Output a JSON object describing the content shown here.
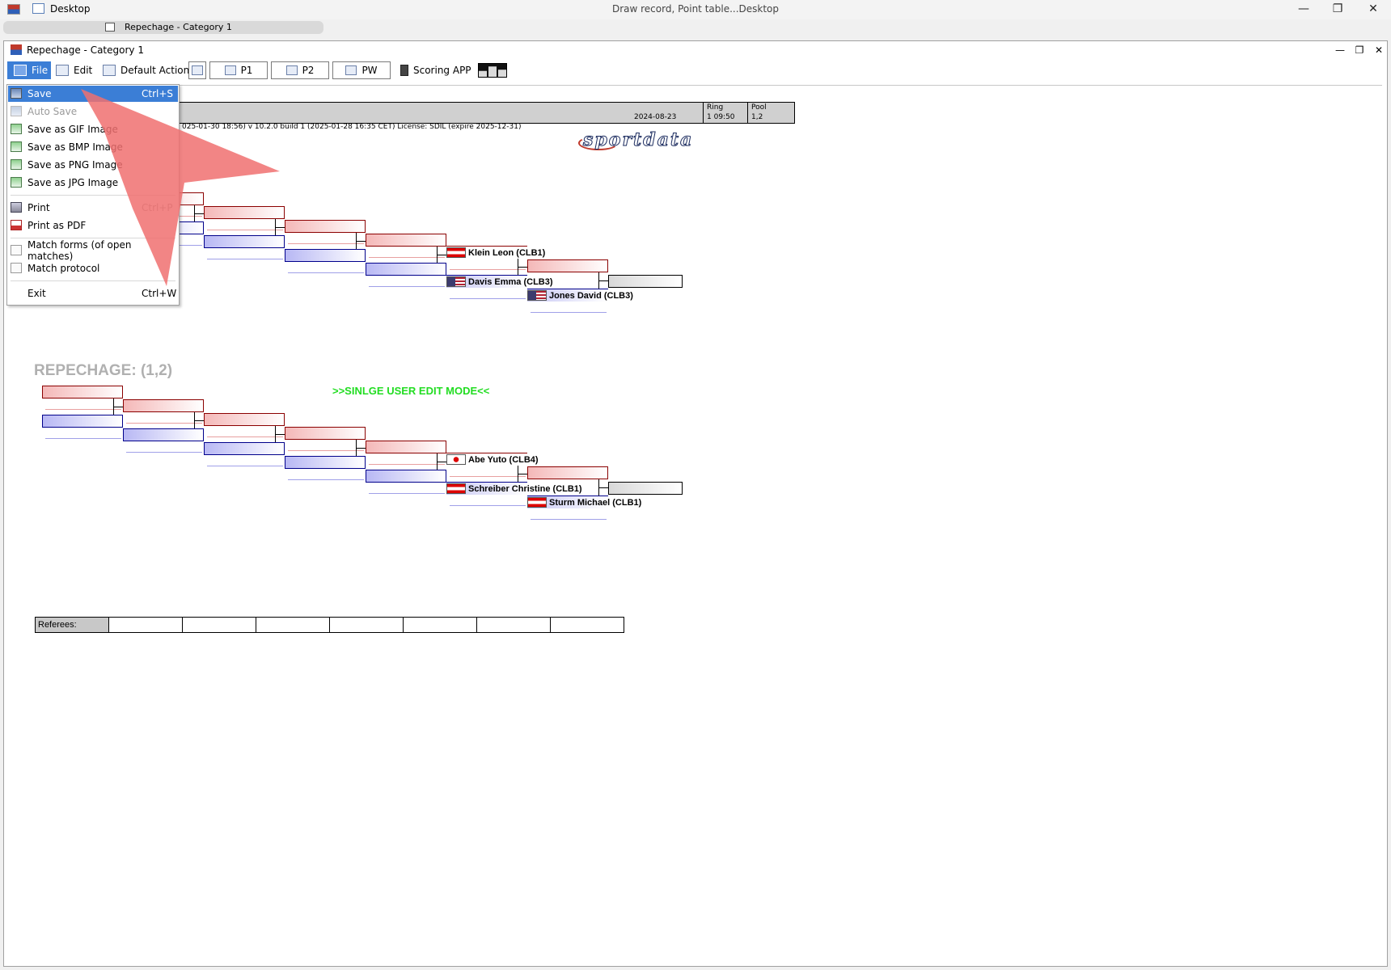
{
  "os": {
    "desktop_label": "Desktop",
    "center_title": "Draw record, Point table...Desktop",
    "tab_label": "Repechage - Category 1",
    "minimize": "—",
    "maximize": "❐",
    "close": "✕"
  },
  "window": {
    "title": "Repechage - Category 1",
    "minimize": "—",
    "restore": "❐",
    "close": "✕"
  },
  "toolbar": {
    "file": "File",
    "edit": "Edit",
    "default_action": "Default Action",
    "p1": "P1",
    "p2": "P2",
    "pw": "PW",
    "scoring_app": "Scoring APP"
  },
  "header": {
    "date": "2024-08-23",
    "ring_caption": "Ring",
    "ring_value": "1 09:50",
    "pool_caption": "Pool",
    "pool_value": "1,2",
    "version_line": "025-01-30 18:56)  v 10.2.0 build 1 (2025-01-28 16:35 CET) License: SDIL (expire 2025-12-31)"
  },
  "logo": {
    "text": "sportdata"
  },
  "section": {
    "title": "REPECHAGE:  (1,2)",
    "mode": ">>SINLGE USER EDIT MODE<<"
  },
  "bracket1": {
    "red_final": "Klein Leon (CLB1)",
    "blue_final": "Davis Emma (CLB3)",
    "blue_last": "Jones David (CLB3)"
  },
  "bracket2": {
    "red_final": "Abe Yuto (CLB4)",
    "blue_final": "Schreiber Christine (CLB1)",
    "blue_last": "Sturm Michael (CLB1)"
  },
  "referees": {
    "label": "Referees:"
  },
  "file_menu": {
    "items": [
      {
        "label": "Save",
        "shortcut": "Ctrl+S"
      },
      {
        "label": "Auto Save",
        "shortcut": ""
      },
      {
        "label": "Save as GIF Image",
        "shortcut": ""
      },
      {
        "label": "Save as BMP Image",
        "shortcut": ""
      },
      {
        "label": "Save as PNG Image",
        "shortcut": ""
      },
      {
        "label": "Save as JPG Image",
        "shortcut": ""
      },
      {
        "label": "Print",
        "shortcut": "Ctrl+P"
      },
      {
        "label": "Print as PDF",
        "shortcut": ""
      },
      {
        "label": "Match forms (of open matches)",
        "shortcut": ""
      },
      {
        "label": "Match protocol",
        "shortcut": ""
      },
      {
        "label": "Exit",
        "shortcut": "Ctrl+W"
      }
    ]
  },
  "colors": {
    "highlight": "#3b7ed6",
    "mode_text": "#22dd22",
    "arrow_overlay": "#f07070"
  }
}
